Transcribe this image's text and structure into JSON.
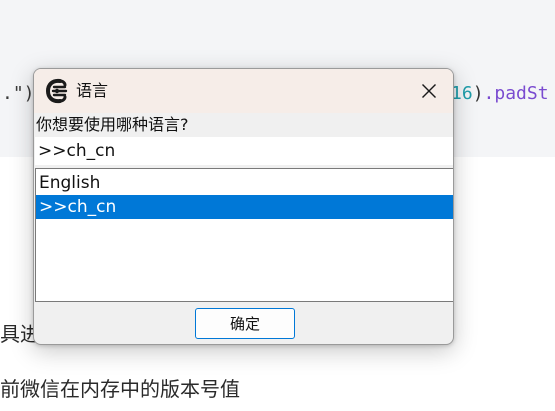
{
  "background": {
    "code_left": ".\")",
    "code_right_number": "16",
    "code_right_paren": ")",
    "code_right_method": ".padSt",
    "line1": "具进行",
    "line2": "前微信在内存中的版本号值"
  },
  "dialog": {
    "title": "语言",
    "app_icon": "cheat-engine-crab-icon",
    "close_icon": "close-icon",
    "prompt": "你想要使用哪种语言?",
    "input_value": ">>ch_cn",
    "options": [
      {
        "label": "English",
        "selected": false
      },
      {
        "label": ">>ch_cn",
        "selected": true
      }
    ],
    "ok_label": "确定"
  },
  "colors": {
    "selection": "#0078d7",
    "titlebar": "#f6ede8",
    "dialog_bg": "#f0f0f0",
    "code_number": "#1f9eab",
    "code_method": "#7a4bd0"
  }
}
